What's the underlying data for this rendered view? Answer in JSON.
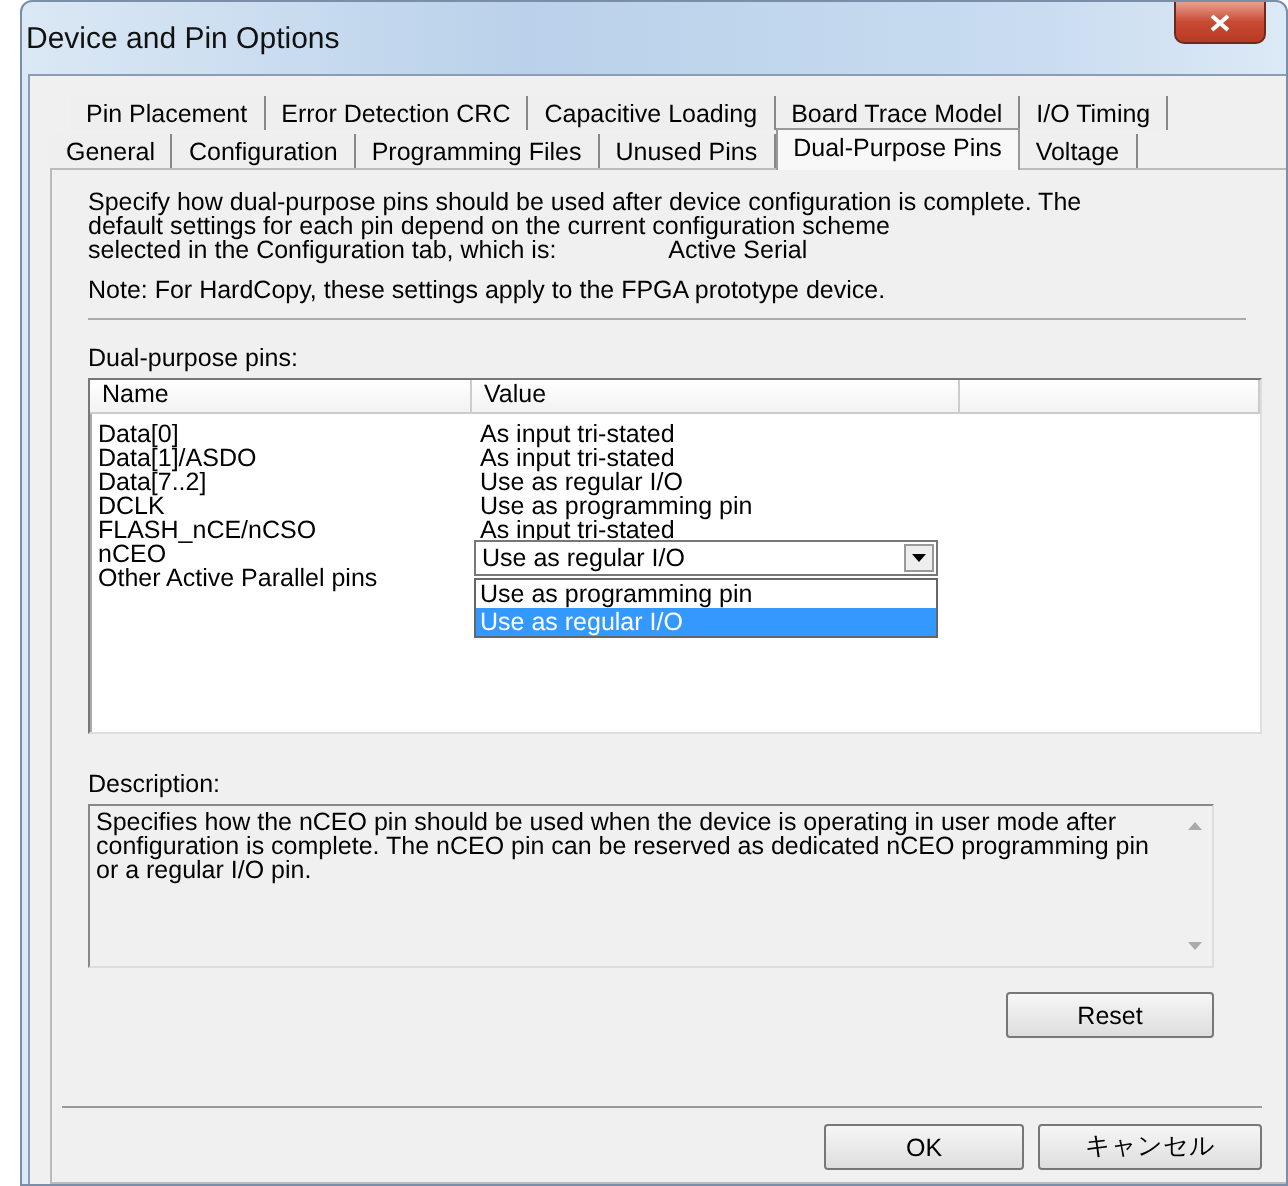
{
  "window": {
    "title": "Device and Pin Options"
  },
  "tab_rows": [
    [
      {
        "label": "Pin Placement",
        "selected": false
      },
      {
        "label": "Error Detection CRC",
        "selected": false
      },
      {
        "label": "Capacitive Loading",
        "selected": false
      },
      {
        "label": "Board Trace Model",
        "selected": false
      },
      {
        "label": "I/O Timing",
        "selected": false
      }
    ],
    [
      {
        "label": "General",
        "selected": false
      },
      {
        "label": "Configuration",
        "selected": false
      },
      {
        "label": "Programming Files",
        "selected": false
      },
      {
        "label": "Unused Pins",
        "selected": false
      },
      {
        "label": "Dual-Purpose Pins",
        "selected": true
      },
      {
        "label": "Voltage",
        "selected": false
      }
    ]
  ],
  "intro": {
    "lines": [
      "Specify how dual-purpose pins should be used after device configuration is complete. The",
      "default settings for each pin depend on the current configuration scheme",
      "selected in the Configuration tab, which is:"
    ],
    "scheme": "Active Serial"
  },
  "note": "Note: For HardCopy, these settings apply to the FPGA prototype device.",
  "pins": {
    "label": "Dual-purpose pins:",
    "columns": [
      "Name",
      "Value"
    ],
    "rows": [
      {
        "kind": "text",
        "name": "Data[0]",
        "value": "As input tri-stated"
      },
      {
        "kind": "text",
        "name": "Data[1]/ASDO",
        "value": "As input tri-stated"
      },
      {
        "kind": "text",
        "name": "Data[7..2]",
        "value": "Use as regular I/O"
      },
      {
        "kind": "text",
        "name": "DCLK",
        "value": "Use as programming pin"
      },
      {
        "kind": "text",
        "name": "FLASH_nCE/nCSO",
        "value": "As input tri-stated"
      },
      {
        "kind": "combo",
        "name": "nCEO",
        "value": "Use as regular I/O",
        "expanded": true,
        "options": [
          {
            "label": "Use as programming pin",
            "selected": false
          },
          {
            "label": "Use as regular I/O",
            "selected": true
          }
        ]
      },
      {
        "kind": "text",
        "name": "Other Active Parallel pins"
      }
    ]
  },
  "description": {
    "label": "Description:",
    "text": "Specifies how the nCEO pin should be used when the device is operating in user mode after configuration is complete. The nCEO pin can be reserved as dedicated nCEO programming pin or a regular I/O pin."
  },
  "reset_button": "Reset",
  "buttons": [
    "OK",
    "キャンセル"
  ]
}
